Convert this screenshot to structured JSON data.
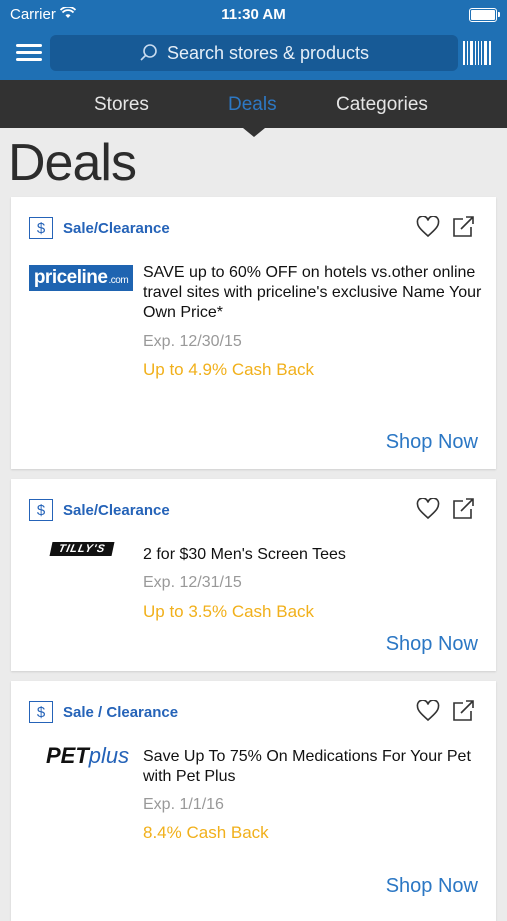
{
  "status": {
    "carrier": "Carrier",
    "time": "11:30 AM"
  },
  "search": {
    "placeholder": "Search stores & products"
  },
  "tabs": [
    {
      "label": "Stores"
    },
    {
      "label": "Deals"
    },
    {
      "label": "Categories"
    }
  ],
  "page_title": "Deals",
  "colors": {
    "brand_blue": "#1f70b4",
    "cashback": "#f1b01b",
    "link": "#2b77c4"
  },
  "deals": [
    {
      "type": "Sale/Clearance",
      "store_logo": "priceline.com",
      "logo_main": "priceline",
      "logo_suffix": ".com",
      "description": "SAVE up to 60% OFF on hotels vs.other online travel sites with priceline's exclusive Name Your Own Price*",
      "expiration": "Exp. 12/30/15",
      "cashback": "Up to 4.9% Cash Back",
      "cta": "Shop Now"
    },
    {
      "type": "Sale/Clearance",
      "store_logo": "TILLY'S",
      "description": "2 for $30 Men's Screen Tees",
      "expiration": "Exp. 12/31/15",
      "cashback": "Up to 3.5% Cash Back",
      "cta": "Shop Now"
    },
    {
      "type": "Sale / Clearance",
      "store_logo": "PETplus",
      "logo_main": "PET",
      "logo_suffix": "plus",
      "description": "Save Up To 75% On Medications For Your Pet with Pet Plus",
      "expiration": "Exp. 1/1/16",
      "cashback": "8.4% Cash Back",
      "cta": "Shop Now"
    }
  ],
  "icons": {
    "menu": "hamburger-icon",
    "search": "search-icon",
    "barcode": "barcode-icon",
    "favorite": "heart-icon",
    "share": "share-icon",
    "deal_type": "dollar-icon"
  }
}
